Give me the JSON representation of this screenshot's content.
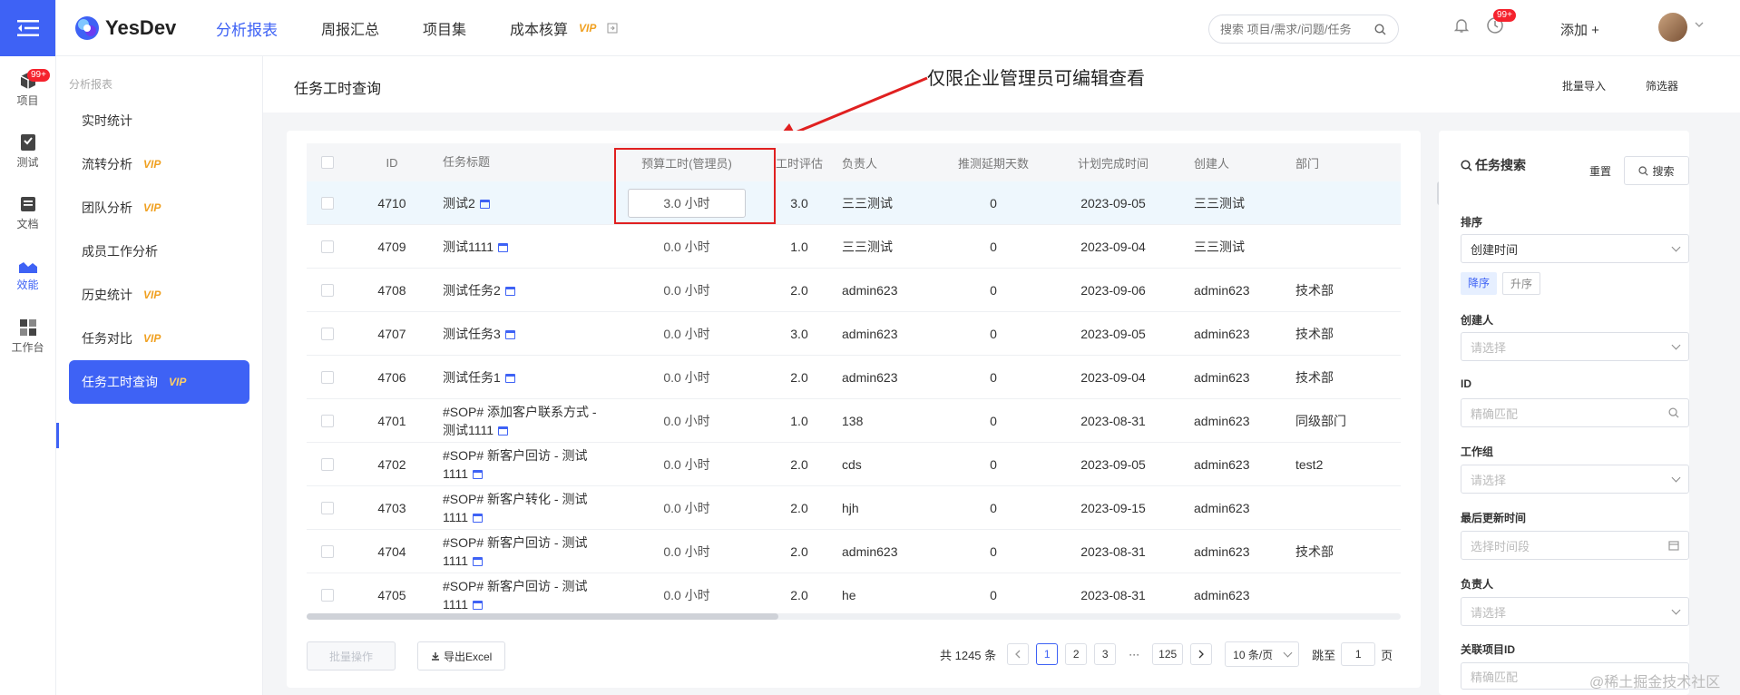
{
  "rail": {
    "items": [
      {
        "label": "项目",
        "badge": "99+"
      },
      {
        "label": "测试"
      },
      {
        "label": "文档"
      },
      {
        "label": "效能"
      },
      {
        "label": "工作台"
      }
    ]
  },
  "header": {
    "logo": "YesDev",
    "nav": [
      {
        "label": "分析报表"
      },
      {
        "label": "周报汇总"
      },
      {
        "label": "项目集"
      },
      {
        "label": "成本核算",
        "vip": "VIP"
      }
    ],
    "search_placeholder": "搜索 项目/需求/问题/任务",
    "notif_badge": "99+",
    "add_label": "添加 +"
  },
  "subside": {
    "section_title": "分析报表",
    "items": [
      {
        "label": "实时统计"
      },
      {
        "label": "流转分析",
        "vip": "VIP"
      },
      {
        "label": "团队分析",
        "vip": "VIP"
      },
      {
        "label": "成员工作分析"
      },
      {
        "label": "历史统计",
        "vip": "VIP"
      },
      {
        "label": "任务对比",
        "vip": "VIP"
      },
      {
        "label": "任务工时查询",
        "vip": "VIP"
      }
    ]
  },
  "page": {
    "title": "任务工时查询",
    "batch_import": "批量导入",
    "filter": "筛选器",
    "annotation": "仅限企业管理员可编辑查看"
  },
  "table": {
    "headers": {
      "id": "ID",
      "title": "任务标题",
      "budget": "预算工时(管理员)",
      "estimate": "工时评估",
      "owner": "负责人",
      "delay": "推测延期天数",
      "plan": "计划完成时间",
      "creator": "创建人",
      "dept": "部门"
    },
    "rows": [
      {
        "id": "4710",
        "title": "测试2",
        "budget": "3.0 小时",
        "estimate": "3.0",
        "owner": "三三测试",
        "delay": "0",
        "plan": "2023-09-05",
        "creator": "三三测试",
        "dept": ""
      },
      {
        "id": "4709",
        "title": "测试1111",
        "budget": "0.0 小时",
        "estimate": "1.0",
        "owner": "三三测试",
        "delay": "0",
        "plan": "2023-09-04",
        "creator": "三三测试",
        "dept": ""
      },
      {
        "id": "4708",
        "title": "测试任务2",
        "budget": "0.0 小时",
        "estimate": "2.0",
        "owner": "admin623",
        "delay": "0",
        "plan": "2023-09-06",
        "creator": "admin623",
        "dept": "技术部"
      },
      {
        "id": "4707",
        "title": "测试任务3",
        "budget": "0.0 小时",
        "estimate": "3.0",
        "owner": "admin623",
        "delay": "0",
        "plan": "2023-09-05",
        "creator": "admin623",
        "dept": "技术部"
      },
      {
        "id": "4706",
        "title": "测试任务1",
        "budget": "0.0 小时",
        "estimate": "2.0",
        "owner": "admin623",
        "delay": "0",
        "plan": "2023-09-04",
        "creator": "admin623",
        "dept": "技术部"
      },
      {
        "id": "4701",
        "title": "#SOP# 添加客户联系方式 - 测试1111",
        "budget": "0.0 小时",
        "estimate": "1.0",
        "owner": "138",
        "delay": "0",
        "plan": "2023-08-31",
        "creator": "admin623",
        "dept": "同级部门"
      },
      {
        "id": "4702",
        "title": "#SOP# 新客户回访 - 测试1111",
        "budget": "0.0 小时",
        "estimate": "2.0",
        "owner": "cds",
        "delay": "0",
        "plan": "2023-09-05",
        "creator": "admin623",
        "dept": "test2"
      },
      {
        "id": "4703",
        "title": "#SOP# 新客户转化 - 测试1111",
        "budget": "0.0 小时",
        "estimate": "2.0",
        "owner": "hjh",
        "delay": "0",
        "plan": "2023-09-15",
        "creator": "admin623",
        "dept": ""
      },
      {
        "id": "4704",
        "title": "#SOP# 新客户回访 - 测试1111",
        "budget": "0.0 小时",
        "estimate": "2.0",
        "owner": "admin623",
        "delay": "0",
        "plan": "2023-08-31",
        "creator": "admin623",
        "dept": "技术部"
      },
      {
        "id": "4705",
        "title": "#SOP# 新客户回访 - 测试1111",
        "budget": "0.0 小时",
        "estimate": "2.0",
        "owner": "he",
        "delay": "0",
        "plan": "2023-08-31",
        "creator": "admin623",
        "dept": ""
      }
    ]
  },
  "footer": {
    "batch_op": "批量操作",
    "export": "导出Excel",
    "total": "共 1245 条",
    "pages": [
      "1",
      "2",
      "3",
      "···",
      "125"
    ],
    "page_size": "10 条/页",
    "jump_label": "跳至",
    "jump_value": "1",
    "jump_suffix": "页"
  },
  "filter_panel": {
    "title": "任务搜索",
    "reset": "重置",
    "search": "搜索",
    "sort_label": "排序",
    "sort_value": "创建时间",
    "sort_desc": "降序",
    "sort_asc": "升序",
    "creator_label": "创建人",
    "creator_placeholder": "请选择",
    "id_label": "ID",
    "id_placeholder": "精确匹配",
    "group_label": "工作组",
    "group_placeholder": "请选择",
    "updated_label": "最后更新时间",
    "updated_placeholder": "选择时间段",
    "owner_label": "负责人",
    "owner_placeholder": "请选择",
    "project_label": "关联项目ID",
    "project_placeholder": "精确匹配"
  },
  "watermark": "@稀土掘金技术社区",
  "colors": {
    "accent": "#3e62f5",
    "vip": "#f0a020",
    "annotation": "#e02020"
  }
}
